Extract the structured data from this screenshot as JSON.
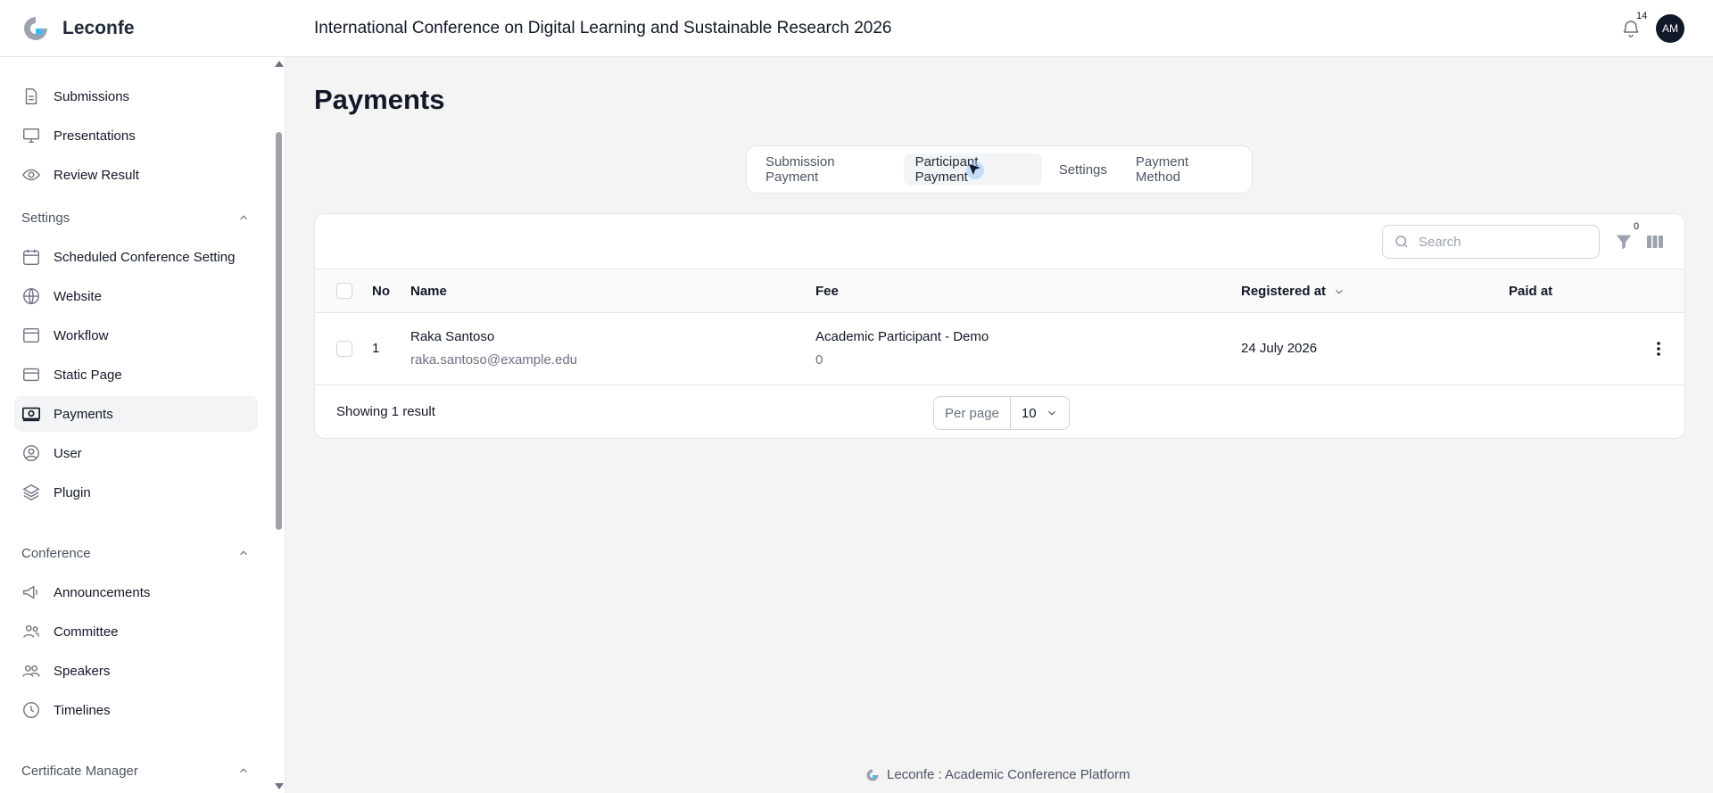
{
  "app": {
    "name": "Leconfe",
    "conference_title": "International Conference on Digital Learning and Sustainable Research 2026"
  },
  "header": {
    "notification_count": "14",
    "avatar_initials": "AM"
  },
  "sidebar": {
    "items_top": [
      {
        "label": "Submissions",
        "icon": "document-icon"
      },
      {
        "label": "Presentations",
        "icon": "monitor-icon"
      },
      {
        "label": "Review Result",
        "icon": "eye-icon"
      }
    ],
    "settings_heading": "Settings",
    "settings_items": [
      {
        "label": "Scheduled Conference Setting",
        "icon": "calendar-icon"
      },
      {
        "label": "Website",
        "icon": "globe-icon"
      },
      {
        "label": "Workflow",
        "icon": "window-icon"
      },
      {
        "label": "Static Page",
        "icon": "card-icon"
      },
      {
        "label": "Payments",
        "icon": "payment-icon",
        "active": true
      },
      {
        "label": "User",
        "icon": "user-circle-icon"
      },
      {
        "label": "Plugin",
        "icon": "stack-icon"
      }
    ],
    "conference_heading": "Conference",
    "conference_items": [
      {
        "label": "Announcements",
        "icon": "megaphone-icon"
      },
      {
        "label": "Committee",
        "icon": "users-icon"
      },
      {
        "label": "Speakers",
        "icon": "speakers-icon"
      },
      {
        "label": "Timelines",
        "icon": "clock-icon"
      }
    ],
    "certificate_heading": "Certificate Manager"
  },
  "page": {
    "title": "Payments"
  },
  "tabs": [
    {
      "label": "Submission Payment",
      "active": false
    },
    {
      "label": "Participant Payment",
      "active": true
    },
    {
      "label": "Settings",
      "active": false
    },
    {
      "label": "Payment Method",
      "active": false
    }
  ],
  "table": {
    "search_placeholder": "Search",
    "filter_count": "0",
    "columns": {
      "no": "No",
      "name": "Name",
      "fee": "Fee",
      "registered_at": "Registered at",
      "paid_at": "Paid at"
    },
    "rows": [
      {
        "no": "1",
        "name": "Raka Santoso",
        "email": "raka.santoso@example.edu",
        "fee_name": "Academic Participant - Demo",
        "fee_amount": "0",
        "registered_at": "24 July 2026",
        "paid_at": ""
      }
    ],
    "showing": "Showing 1 result",
    "per_page_label": "Per page",
    "per_page_value": "10"
  },
  "footer": {
    "text": "Leconfe : Academic Conference Platform"
  },
  "colors": {
    "accent": "#38bdf8",
    "dark": "#111827",
    "muted": "#6b7280",
    "border": "#e5e7eb"
  }
}
